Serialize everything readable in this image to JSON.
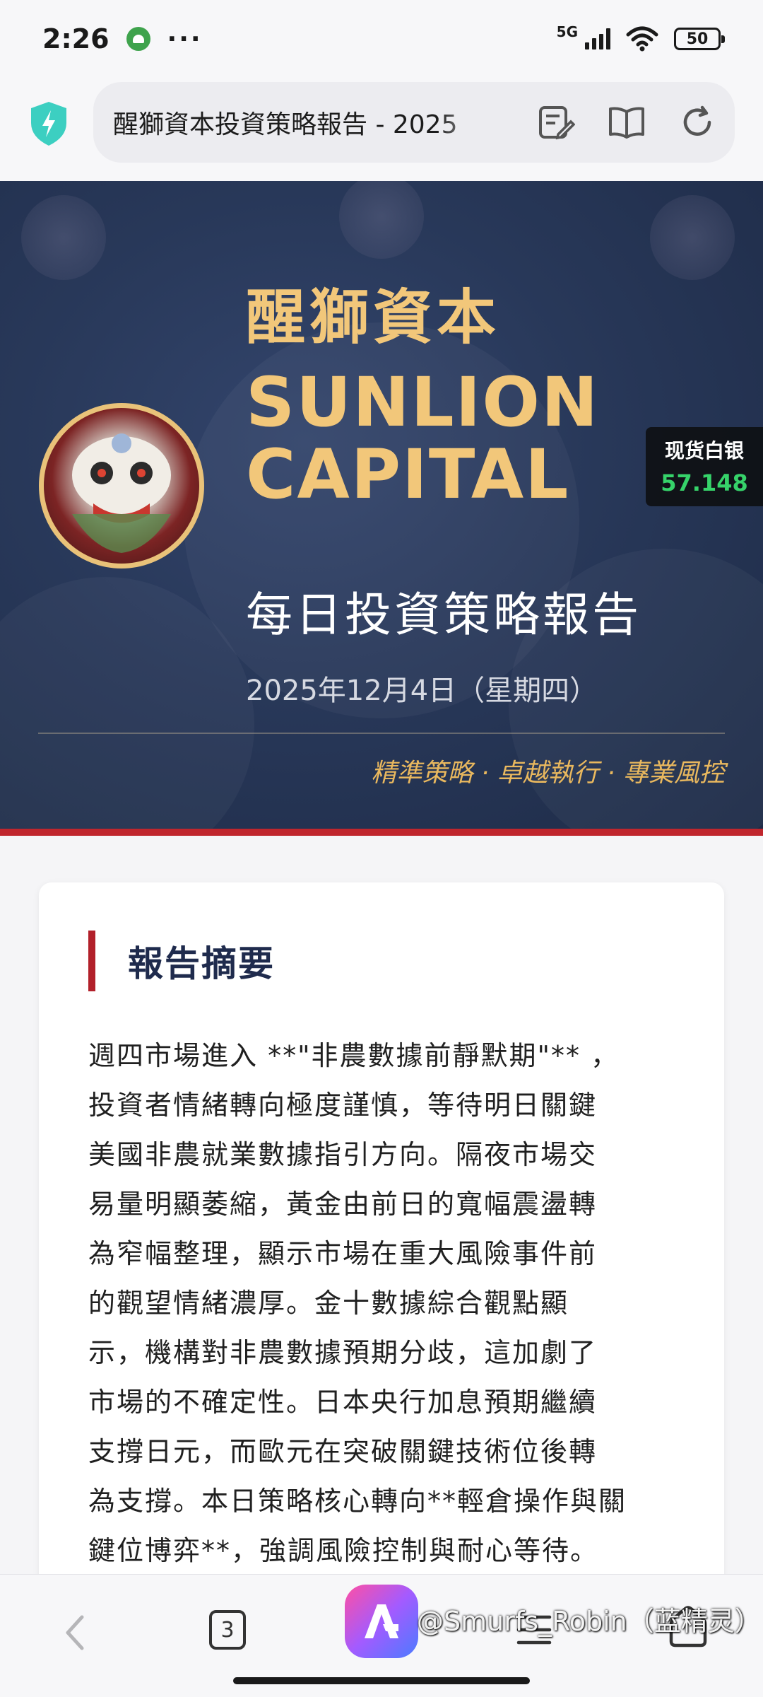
{
  "status_bar": {
    "time": "2:26",
    "more": "···",
    "network": "5G",
    "battery": "50"
  },
  "browser": {
    "url_text": "醒獅資本投資策略報告 - 2025",
    "tab_count": "3"
  },
  "hero": {
    "title_cn": "醒獅資本",
    "title_en_line1": "SUNLION",
    "title_en_line2": "CAPITAL",
    "subtitle": "每日投資策略報告",
    "date": "2025年12月4日（星期四）",
    "tagline": "精準策略 · 卓越執行 · 專業風控"
  },
  "ticker": {
    "label": "现货白银",
    "value": "57.148"
  },
  "summary": {
    "heading": "報告摘要",
    "lines": [
      "週四市場進入 **\"非農數據前靜默期\"** ，",
      "投資者情緒轉向極度謹慎，等待明日關鍵",
      "美國非農就業數據指引方向。隔夜市場交",
      "易量明顯萎縮，黃金由前日的寬幅震盪轉",
      "為窄幅整理，顯示市場在重大風險事件前",
      "的觀望情緒濃厚。金十數據綜合觀點顯",
      "示，機構對非農數據預期分歧，這加劇了",
      "市場的不確定性。日本央行加息預期繼續",
      "支撐日元，而歐元在突破關鍵技術位後轉",
      "為支撐。本日策略核心轉向**輕倉操作與關",
      "鍵位博弈**，強調風險控制與耐心等待。"
    ]
  },
  "watermark": "@Smurfs_Robin（蓝精灵）",
  "colors": {
    "accent_gold": "#f2c77a",
    "hero_bg": "#283859",
    "accent_red": "#c0262d",
    "ticker_green": "#36d36a"
  }
}
